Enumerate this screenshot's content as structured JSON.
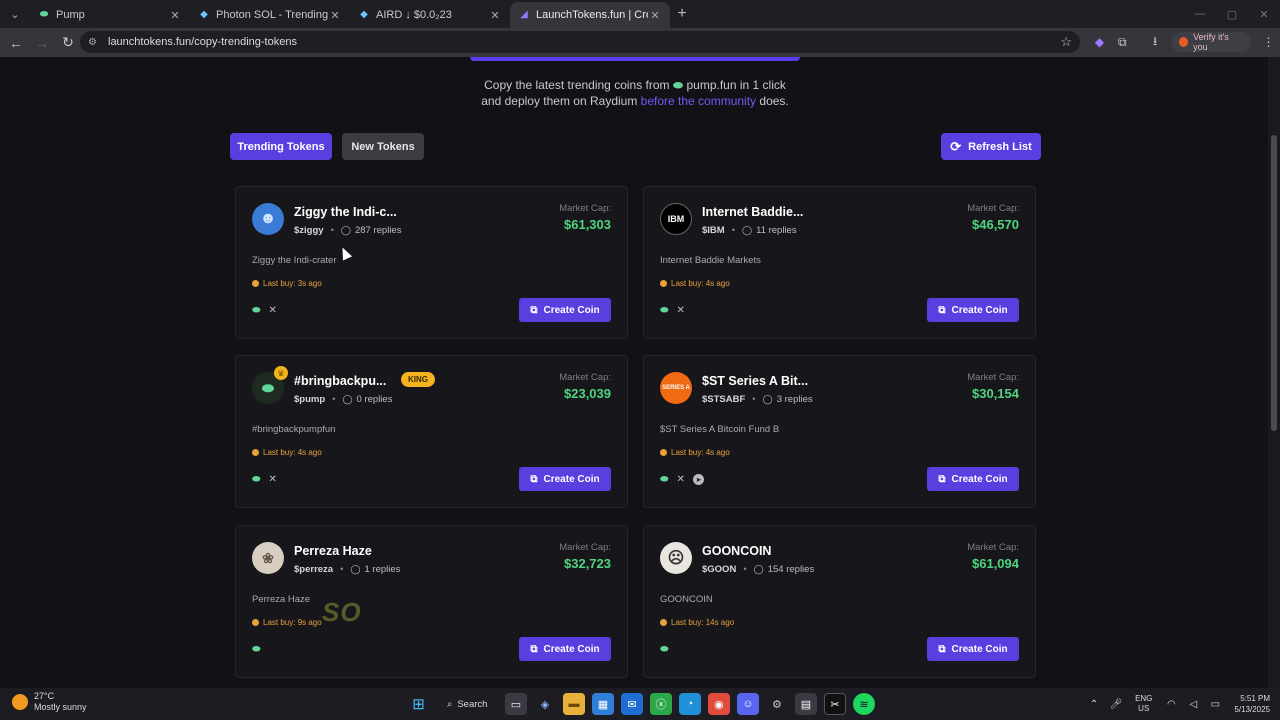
{
  "browser": {
    "tabs": [
      {
        "title": "Pump",
        "icon": "pill-icon",
        "active": false
      },
      {
        "title": "Photon SOL - Trending",
        "icon": "photon-icon",
        "active": false
      },
      {
        "title": "AIRD ↓ $0.0₂23",
        "icon": "photon-icon",
        "active": false
      },
      {
        "title": "LaunchTokens.fun | Create Sola",
        "icon": "launchtokens-icon",
        "active": true
      }
    ],
    "url": "launchtokens.fun/copy-trending-tokens",
    "profile_label": "Verify it's you"
  },
  "page": {
    "subtitle_line1_a": "Copy the latest trending coins from",
    "subtitle_line1_b": "pump.fun in 1 click",
    "subtitle_line2_a": "and deploy them on Raydium",
    "subtitle_line2_link": "before the community",
    "subtitle_line2_b": "does.",
    "tab_trending": "Trending Tokens",
    "tab_new": "New Tokens",
    "refresh_label": "Refresh List",
    "market_cap_label": "Market Cap:",
    "create_label": "Create Coin",
    "king_label": "KING"
  },
  "tokens": [
    {
      "name": "Ziggy the Indi-c...",
      "symbol": "$ziggy",
      "replies": "287 replies",
      "desc": "Ziggy the Indi-crater",
      "last_buy": "Last buy: 3s ago",
      "mcap": "$61,303",
      "socials": [
        "pill",
        "x"
      ],
      "avatar": "ziggy-avatar",
      "avatar_color": "#3a7bd5",
      "king": false
    },
    {
      "name": "Internet Baddie...",
      "symbol": "$IBM",
      "replies": "11 replies",
      "desc": "Internet Baddie Markets",
      "last_buy": "Last buy: 4s ago",
      "mcap": "$46,570",
      "socials": [
        "pill",
        "x"
      ],
      "avatar": "ibm-avatar",
      "avatar_text": "IBM",
      "avatar_color": "#000000",
      "king": false
    },
    {
      "name": "#bringbackpu...",
      "symbol": "$pump",
      "replies": "0 replies",
      "desc": "#bringbackpumpfun",
      "last_buy": "Last buy: 4s ago",
      "mcap": "$23,039",
      "socials": [
        "pill",
        "x"
      ],
      "avatar": "pump-pill-avatar",
      "avatar_color": "#1e2a22",
      "king": true
    },
    {
      "name": "$ST Series A Bit...",
      "symbol": "$STSABF",
      "replies": "3 replies",
      "desc": "$ST Series A Bitcoin Fund B",
      "last_buy": "Last buy: 4s ago",
      "mcap": "$30,154",
      "socials": [
        "pill",
        "x",
        "telegram"
      ],
      "avatar": "st-series-avatar",
      "avatar_color": "#f06a12",
      "king": false
    },
    {
      "name": "Perreza Haze",
      "symbol": "$perreza",
      "replies": "1 replies",
      "desc": "Perreza Haze",
      "last_buy": "Last buy: 9s ago",
      "mcap": "$32,723",
      "socials": [
        "pill"
      ],
      "avatar": "perreza-avatar",
      "avatar_color": "#d8cfc2",
      "king": false
    },
    {
      "name": "GOONCOIN",
      "symbol": "$GOON",
      "replies": "154 replies",
      "desc": "GOONCOIN",
      "last_buy": "Last buy: 14s ago",
      "mcap": "$61,094",
      "socials": [
        "pill"
      ],
      "avatar": "gooncoin-avatar",
      "avatar_color": "#e9e6df",
      "king": false
    }
  ],
  "overlay_text": "SO",
  "taskbar": {
    "temp": "27°C",
    "weather": "Mostly sunny",
    "search": "Search",
    "lang1": "ENG",
    "lang2": "US",
    "time": "5:51 PM",
    "date": "5/13/2025"
  }
}
